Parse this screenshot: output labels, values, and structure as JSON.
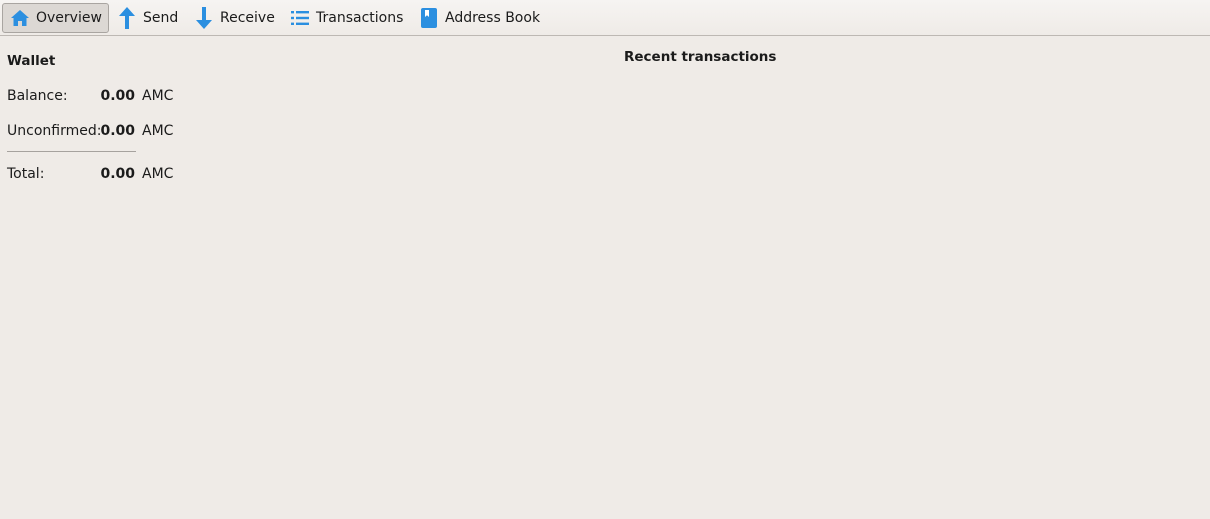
{
  "toolbar": {
    "items": [
      {
        "label": "Overview",
        "icon": "home-icon",
        "active": true
      },
      {
        "label": "Send",
        "icon": "arrow-up-icon"
      },
      {
        "label": "Receive",
        "icon": "arrow-down-icon"
      },
      {
        "label": "Transactions",
        "icon": "list-icon"
      },
      {
        "label": "Address Book",
        "icon": "book-icon"
      }
    ],
    "icon_color": "#2b8fe0"
  },
  "wallet": {
    "title": "Wallet",
    "balance": {
      "label": "Balance:",
      "value": "0.00",
      "unit": "AMC"
    },
    "unconfirmed": {
      "label": "Unconfirmed:",
      "value": "0.00",
      "unit": "AMC"
    },
    "total": {
      "label": "Total:",
      "value": "0.00",
      "unit": "AMC"
    }
  },
  "recent": {
    "title": "Recent transactions",
    "items": []
  },
  "colors": {
    "background": "#efebe7",
    "accent": "#2b8fe0"
  }
}
